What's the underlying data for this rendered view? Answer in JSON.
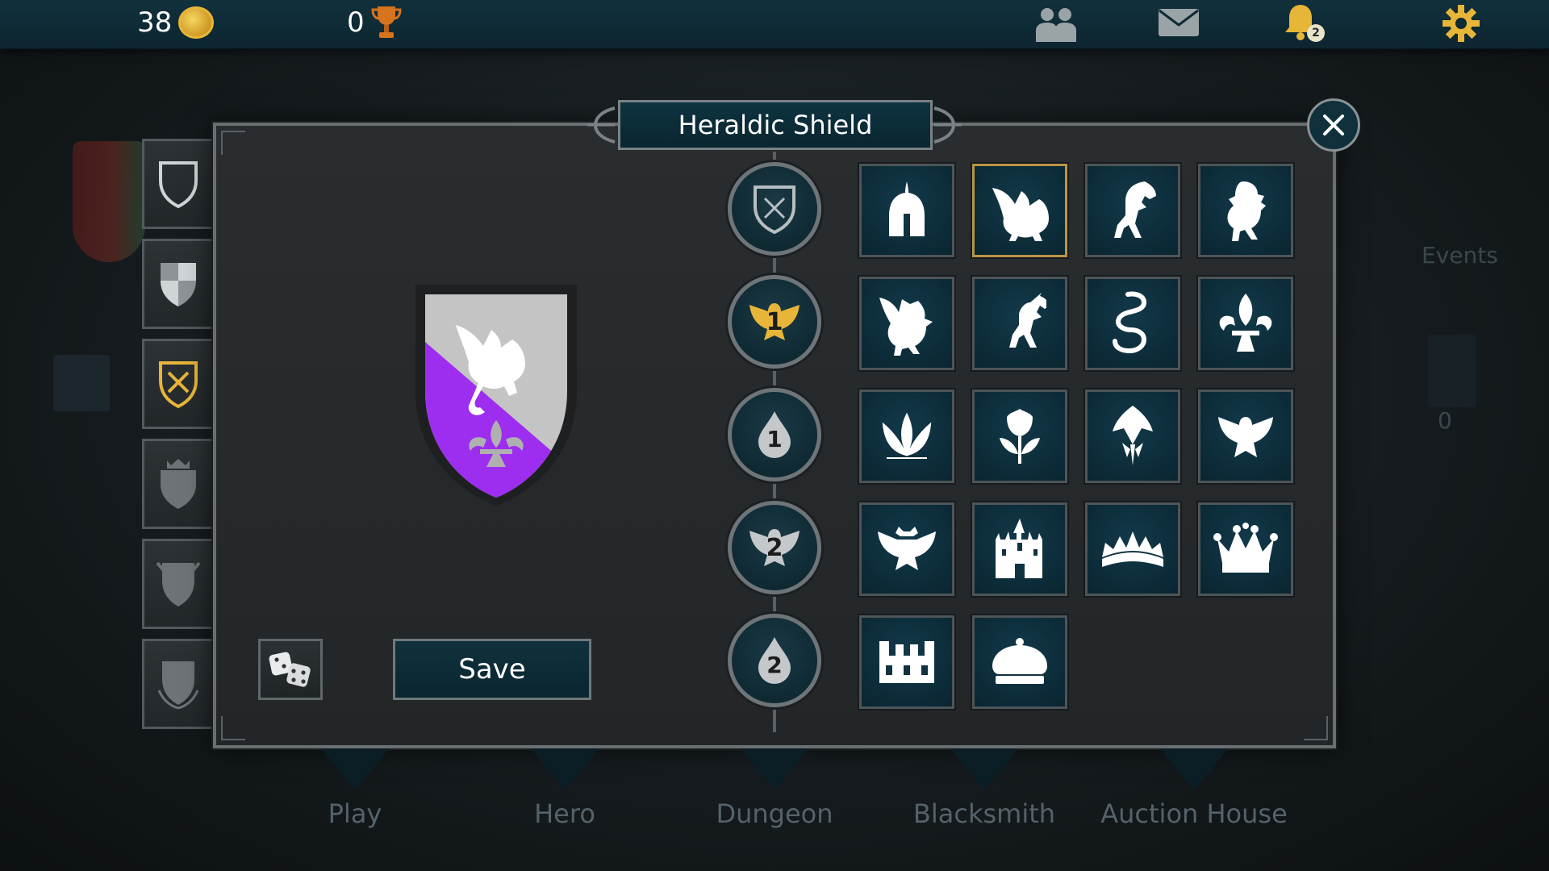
{
  "topbar": {
    "coins": "38",
    "trophies": "0",
    "notification_count": "2",
    "icons": [
      "coin-icon",
      "trophy-icon",
      "friends-icon",
      "mail-icon",
      "bell-icon",
      "gear-icon"
    ]
  },
  "dialog": {
    "title": "Heraldic Shield",
    "save_label": "Save",
    "categories": [
      {
        "name": "shield-shape",
        "label": ""
      },
      {
        "name": "charge-1",
        "label": "1"
      },
      {
        "name": "tincture-1",
        "label": "1"
      },
      {
        "name": "charge-2",
        "label": "2"
      },
      {
        "name": "tincture-2",
        "label": "2"
      }
    ],
    "emblems": [
      "helmet",
      "dragon",
      "horse-rampant",
      "lion-rampant",
      "griffin",
      "unicorn",
      "serpent",
      "fleur-de-lis",
      "lily-leaves",
      "tulip",
      "lily-flower",
      "eagle",
      "double-eagle",
      "castle",
      "ducal-crown",
      "royal-crown",
      "mural-crown",
      "imperial-crown"
    ],
    "selected_emblem": "dragon",
    "preview_colors": {
      "field_1": "#9d2ef0",
      "field_2": "#c4c4c4",
      "border": "#1d1f20"
    }
  },
  "bottom_nav": [
    "Play",
    "Hero",
    "Dungeon",
    "Blacksmith",
    "Auction House"
  ],
  "background": {
    "events_label": "Events",
    "zero_label": "0"
  },
  "colors": {
    "accent_gold": "#b99447",
    "panel_teal": "#0e3340"
  }
}
